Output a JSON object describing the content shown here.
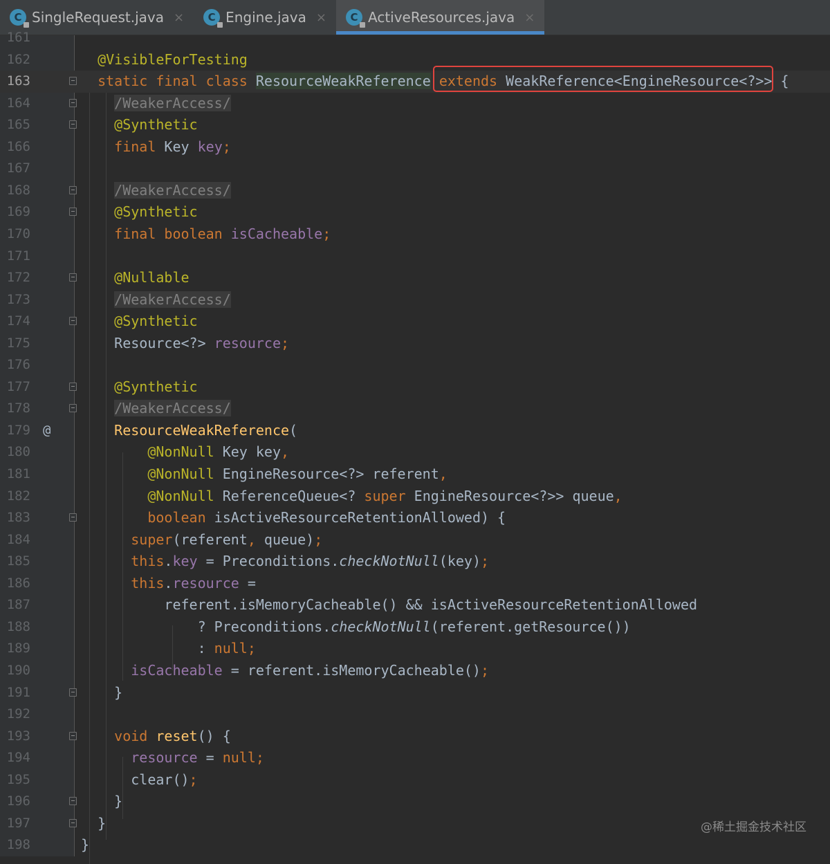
{
  "tabs": [
    {
      "label": "SingleRequest.java",
      "active": false,
      "icon": "java-class-icon"
    },
    {
      "label": "Engine.java",
      "active": false,
      "icon": "java-class-icon"
    },
    {
      "label": "ActiveResources.java",
      "active": true,
      "icon": "java-class-icon"
    }
  ],
  "tab_icon_letter": "C",
  "close_glyph": "×",
  "highlight_color": "#e0443e",
  "watermark": "@稀土掘金技术社区",
  "lines": [
    {
      "n": "161",
      "tokens": []
    },
    {
      "n": "162",
      "tokens": [
        [
          "  ",
          "t"
        ],
        [
          "@VisibleForTesting",
          "a"
        ]
      ]
    },
    {
      "n": "163",
      "current": true,
      "fold": true,
      "tokens": [
        [
          "  ",
          "t"
        ],
        [
          "static final class",
          "k"
        ],
        [
          " ",
          "t"
        ],
        [
          "ResourceWeakReference",
          "hl"
        ],
        [
          " ",
          "t"
        ],
        [
          "extends",
          "k"
        ],
        [
          " WeakReference<EngineResource<?>>",
          "t"
        ],
        [
          " {",
          "t"
        ]
      ]
    },
    {
      "n": "164",
      "fold": true,
      "tokens": [
        [
          "    ",
          "t"
        ],
        [
          "/WeakerAccess/",
          "c"
        ]
      ]
    },
    {
      "n": "165",
      "fold": true,
      "tokens": [
        [
          "    ",
          "t"
        ],
        [
          "@Synthetic",
          "a"
        ]
      ]
    },
    {
      "n": "166",
      "tokens": [
        [
          "    ",
          "t"
        ],
        [
          "final",
          "k"
        ],
        [
          " Key ",
          "t"
        ],
        [
          "key",
          "f"
        ],
        [
          ";",
          "k"
        ]
      ]
    },
    {
      "n": "167",
      "tokens": []
    },
    {
      "n": "168",
      "fold": true,
      "tokens": [
        [
          "    ",
          "t"
        ],
        [
          "/WeakerAccess/",
          "c"
        ]
      ]
    },
    {
      "n": "169",
      "fold": true,
      "tokens": [
        [
          "    ",
          "t"
        ],
        [
          "@Synthetic",
          "a"
        ]
      ]
    },
    {
      "n": "170",
      "tokens": [
        [
          "    ",
          "t"
        ],
        [
          "final boolean",
          "k"
        ],
        [
          " ",
          "t"
        ],
        [
          "isCacheable",
          "f"
        ],
        [
          ";",
          "k"
        ]
      ]
    },
    {
      "n": "171",
      "tokens": []
    },
    {
      "n": "172",
      "fold": true,
      "tokens": [
        [
          "    ",
          "t"
        ],
        [
          "@Nullable",
          "a"
        ]
      ]
    },
    {
      "n": "173",
      "tokens": [
        [
          "    ",
          "t"
        ],
        [
          "/WeakerAccess/",
          "c"
        ]
      ]
    },
    {
      "n": "174",
      "fold": true,
      "tokens": [
        [
          "    ",
          "t"
        ],
        [
          "@Synthetic",
          "a"
        ]
      ]
    },
    {
      "n": "175",
      "tokens": [
        [
          "    ",
          "t"
        ],
        [
          "Resource<?> ",
          "t"
        ],
        [
          "resource",
          "f"
        ],
        [
          ";",
          "k"
        ]
      ]
    },
    {
      "n": "176",
      "tokens": []
    },
    {
      "n": "177",
      "fold": true,
      "tokens": [
        [
          "    ",
          "t"
        ],
        [
          "@Synthetic",
          "a"
        ]
      ]
    },
    {
      "n": "178",
      "fold": true,
      "tokens": [
        [
          "    ",
          "t"
        ],
        [
          "/WeakerAccess/",
          "c"
        ]
      ]
    },
    {
      "n": "179",
      "mark": "@",
      "tokens": [
        [
          "    ",
          "t"
        ],
        [
          "ResourceWeakReference",
          "m"
        ],
        [
          "(",
          "t"
        ]
      ]
    },
    {
      "n": "180",
      "tokens": [
        [
          "        ",
          "t"
        ],
        [
          "@NonNull",
          "a"
        ],
        [
          " Key key",
          "t"
        ],
        [
          ",",
          "k"
        ]
      ]
    },
    {
      "n": "181",
      "tokens": [
        [
          "        ",
          "t"
        ],
        [
          "@NonNull",
          "a"
        ],
        [
          " EngineResource<?> referent",
          "t"
        ],
        [
          ",",
          "k"
        ]
      ]
    },
    {
      "n": "182",
      "tokens": [
        [
          "        ",
          "t"
        ],
        [
          "@NonNull",
          "a"
        ],
        [
          " ReferenceQueue<? ",
          "t"
        ],
        [
          "super",
          "k"
        ],
        [
          " EngineResource<?>> queue",
          "t"
        ],
        [
          ",",
          "k"
        ]
      ]
    },
    {
      "n": "183",
      "fold": true,
      "tokens": [
        [
          "        ",
          "t"
        ],
        [
          "boolean",
          "k"
        ],
        [
          " isActiveResourceRetentionAllowed) {",
          "t"
        ]
      ]
    },
    {
      "n": "184",
      "tokens": [
        [
          "      ",
          "t"
        ],
        [
          "super",
          "k"
        ],
        [
          "(referent",
          "t"
        ],
        [
          ",",
          "k"
        ],
        [
          " queue)",
          "t"
        ],
        [
          ";",
          "k"
        ]
      ]
    },
    {
      "n": "185",
      "tokens": [
        [
          "      ",
          "t"
        ],
        [
          "this",
          "k"
        ],
        [
          ".",
          "t"
        ],
        [
          "key",
          "f"
        ],
        [
          " = Preconditions.",
          "t"
        ],
        [
          "checkNotNull",
          "i"
        ],
        [
          "(key)",
          "t"
        ],
        [
          ";",
          "k"
        ]
      ]
    },
    {
      "n": "186",
      "tokens": [
        [
          "      ",
          "t"
        ],
        [
          "this",
          "k"
        ],
        [
          ".",
          "t"
        ],
        [
          "resource",
          "f"
        ],
        [
          " =",
          "t"
        ]
      ]
    },
    {
      "n": "187",
      "tokens": [
        [
          "          ",
          "t"
        ],
        [
          "referent.isMemoryCacheable() && isActiveResourceRetentionAllowed",
          "t"
        ]
      ]
    },
    {
      "n": "188",
      "tokens": [
        [
          "              ",
          "t"
        ],
        [
          "? Preconditions.",
          "t"
        ],
        [
          "checkNotNull",
          "i"
        ],
        [
          "(referent.getResource())",
          "t"
        ]
      ]
    },
    {
      "n": "189",
      "tokens": [
        [
          "              ",
          "t"
        ],
        [
          ": ",
          "t"
        ],
        [
          "null",
          "k"
        ],
        [
          ";",
          "k"
        ]
      ]
    },
    {
      "n": "190",
      "tokens": [
        [
          "      ",
          "t"
        ],
        [
          "isCacheable",
          "f"
        ],
        [
          " = referent.isMemoryCacheable()",
          "t"
        ],
        [
          ";",
          "k"
        ]
      ]
    },
    {
      "n": "191",
      "fold": true,
      "tokens": [
        [
          "    ",
          "t"
        ],
        [
          "}",
          "t"
        ]
      ]
    },
    {
      "n": "192",
      "tokens": []
    },
    {
      "n": "193",
      "fold": true,
      "tokens": [
        [
          "    ",
          "t"
        ],
        [
          "void",
          "k"
        ],
        [
          " ",
          "t"
        ],
        [
          "reset",
          "m"
        ],
        [
          "() {",
          "t"
        ]
      ]
    },
    {
      "n": "194",
      "tokens": [
        [
          "      ",
          "t"
        ],
        [
          "resource",
          "f"
        ],
        [
          " = ",
          "t"
        ],
        [
          "null",
          "k"
        ],
        [
          ";",
          "k"
        ]
      ]
    },
    {
      "n": "195",
      "tokens": [
        [
          "      ",
          "t"
        ],
        [
          "clear()",
          "t"
        ],
        [
          ";",
          "k"
        ]
      ]
    },
    {
      "n": "196",
      "fold": true,
      "tokens": [
        [
          "    ",
          "t"
        ],
        [
          "}",
          "t"
        ]
      ]
    },
    {
      "n": "197",
      "fold": true,
      "tokens": [
        [
          "  ",
          "t"
        ],
        [
          "}",
          "t"
        ]
      ]
    },
    {
      "n": "198",
      "tokens": [
        [
          "}",
          "t"
        ]
      ]
    }
  ]
}
